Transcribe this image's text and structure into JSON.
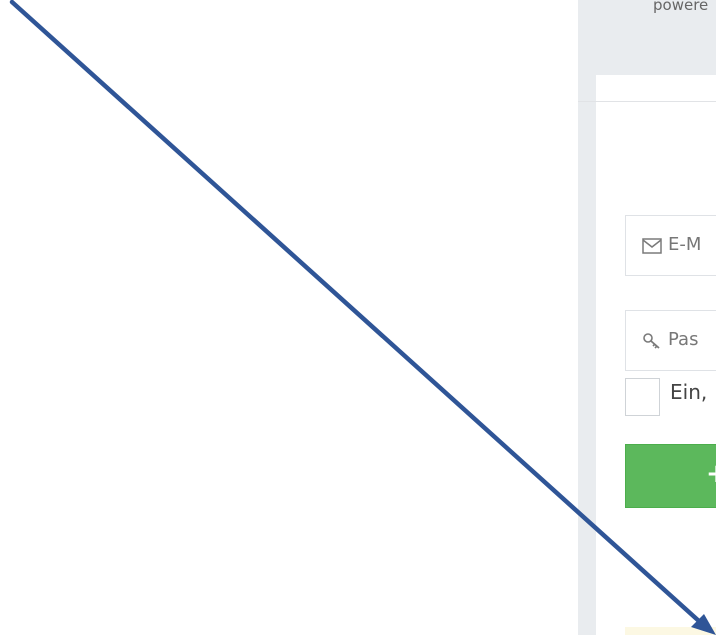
{
  "header": {
    "powered_text": "powere"
  },
  "form": {
    "email_placeholder": "E-M",
    "password_placeholder": "Pas",
    "remember_label": "Ein,",
    "submit_icon": "+"
  },
  "colors": {
    "panel_bg": "#e9ecef",
    "submit_green": "#5cb85c",
    "arrow_blue": "#2f5597"
  },
  "icons": {
    "email": "envelope-icon",
    "password": "key-icon",
    "submit": "sign-in-icon"
  }
}
